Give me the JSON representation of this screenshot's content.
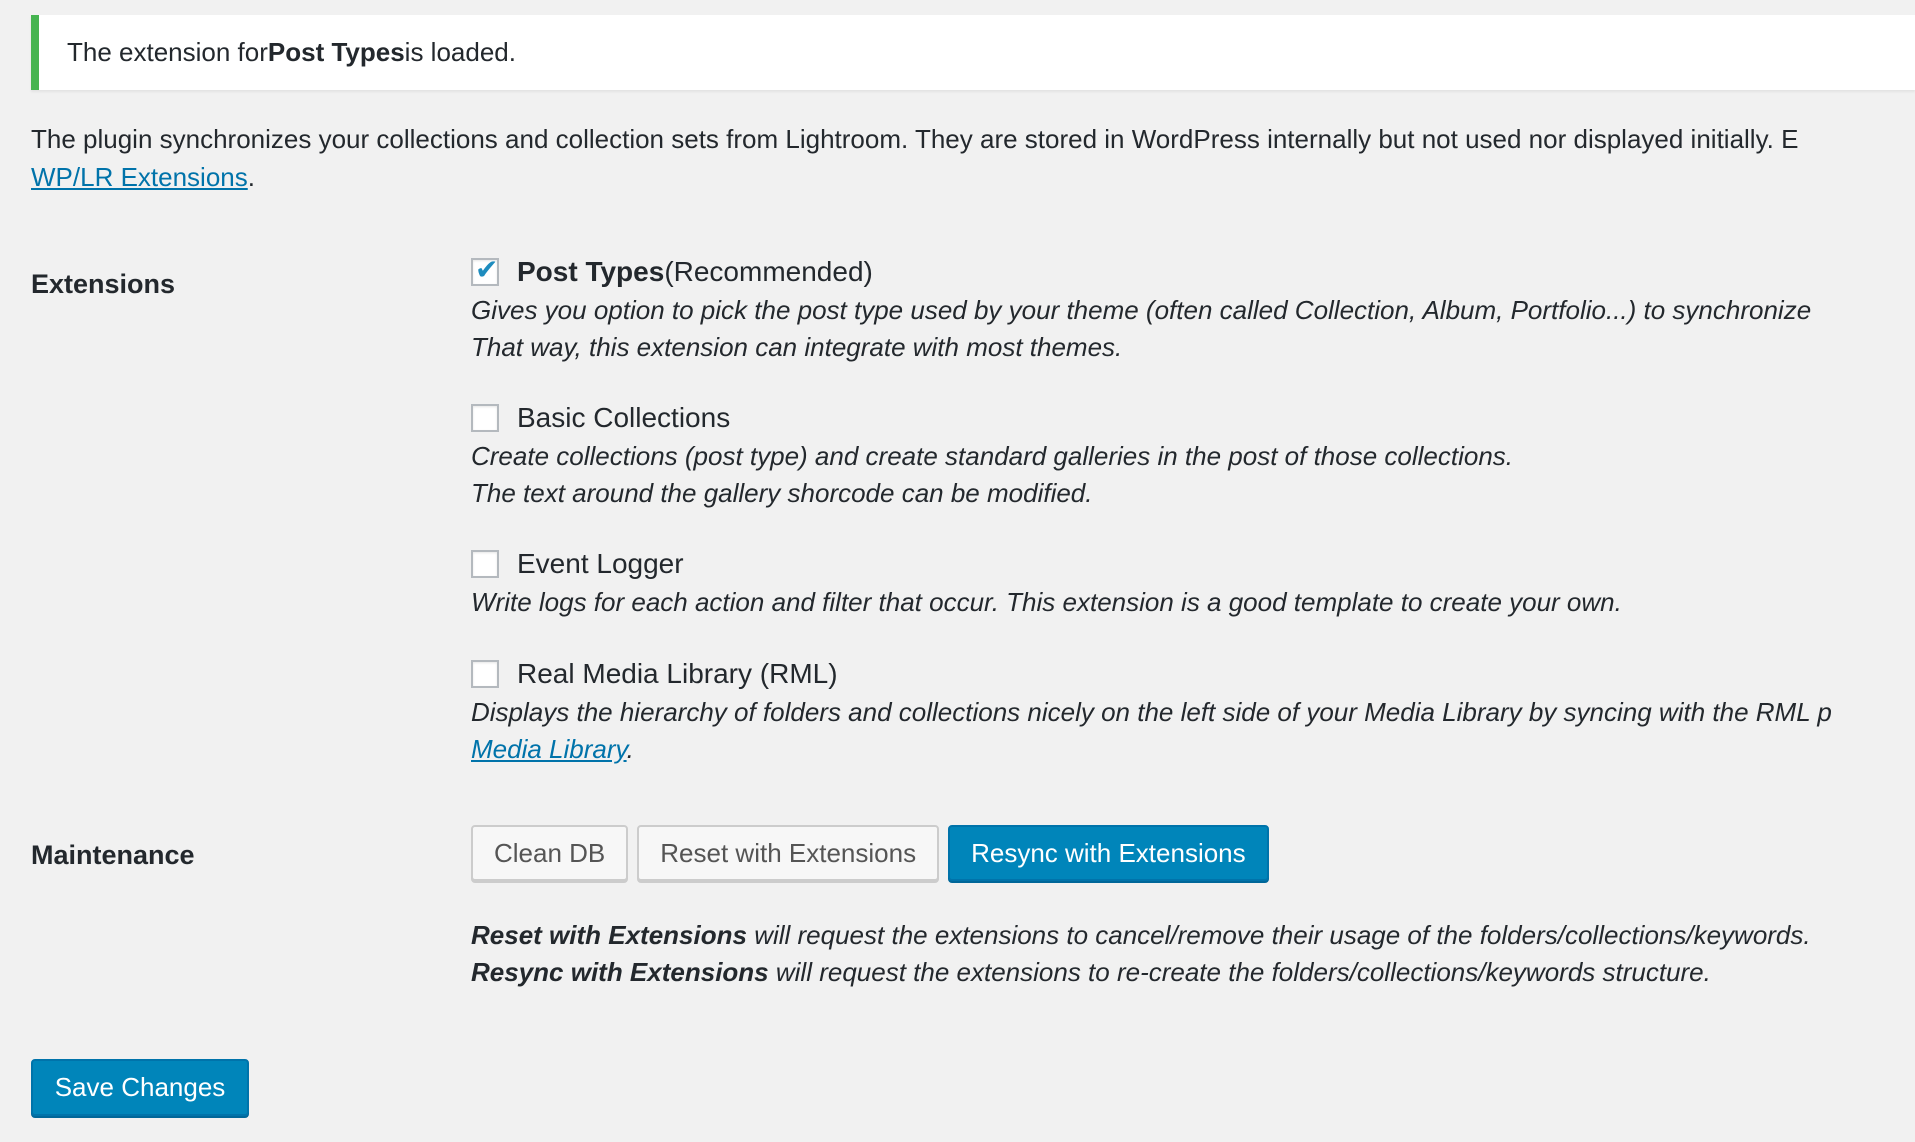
{
  "notice": {
    "prefix": "The extension for ",
    "bold": "Post Types",
    "suffix": " is loaded."
  },
  "intro": {
    "text": "The plugin synchronizes your collections and collection sets from Lightroom. They are stored in WordPress internally but not used nor displayed initially. E",
    "link_text": "WP/LR Extensions",
    "after_link": "."
  },
  "extensions": {
    "label": "Extensions",
    "items": [
      {
        "checked": true,
        "name": "Post Types",
        "suffix": " (Recommended)",
        "desc_lines": [
          "Gives you option to pick the post type used by your theme (often called Collection, Album, Portfolio...) to synchronize",
          "That way, this extension can integrate with most themes."
        ]
      },
      {
        "checked": false,
        "name": "Basic Collections",
        "suffix": "",
        "desc_lines": [
          "Create collections (post type) and create standard galleries in the post of those collections.",
          "The text around the gallery shorcode can be modified."
        ]
      },
      {
        "checked": false,
        "name": "Event Logger",
        "suffix": "",
        "desc_lines": [
          "Write logs for each action and filter that occur. This extension is a good template to create your own."
        ]
      },
      {
        "checked": false,
        "name": "Real Media Library (RML)",
        "suffix": "",
        "desc_lines": [
          "Displays the hierarchy of folders and collections nicely on the left side of your Media Library by syncing with the RML p"
        ],
        "desc_link": "Media Library",
        "desc_link_after": "."
      }
    ]
  },
  "maintenance": {
    "label": "Maintenance",
    "buttons": {
      "clean_db": "Clean DB",
      "reset": "Reset with Extensions",
      "resync": "Resync with Extensions"
    },
    "notes": [
      {
        "bold": "Reset with Extensions",
        "text": " will request the extensions to cancel/remove their usage of the folders/collections/keywords."
      },
      {
        "bold": "Resync with Extensions",
        "text": " will request the extensions to re-create the folders/collections/keywords structure."
      }
    ]
  },
  "save_button": "Save Changes",
  "colors": {
    "notice_border": "#46b450",
    "primary": "#0085ba",
    "link": "#0073aa",
    "check": "#1e8cbe"
  },
  "icons": {
    "check": "checkmark-icon"
  }
}
